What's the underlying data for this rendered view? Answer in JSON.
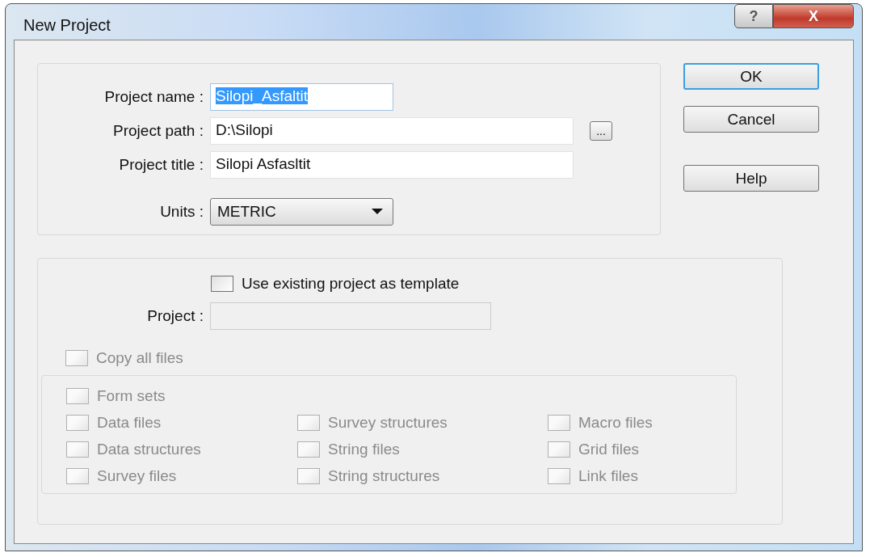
{
  "window": {
    "title": "New Project",
    "help_button": "?",
    "close_button": "X"
  },
  "fields": [
    {
      "label": "Project name :",
      "value": "Silopi_Asfaltit",
      "text_highlighted": true,
      "kind": "text"
    },
    {
      "label": "Project path :",
      "value": "D:\\Silopi",
      "kind": "browse",
      "browse_button": "..."
    },
    {
      "label": "Project title :",
      "value": "Silopi Asfasltit",
      "kind": "text"
    },
    {
      "label": "Units :",
      "value": "METRIC",
      "kind": "dropdown"
    }
  ],
  "buttons": [
    {
      "label": "OK",
      "default": true
    },
    {
      "label": "Cancel",
      "default": false
    },
    {
      "label": "Help",
      "default": false
    }
  ],
  "template": {
    "checkbox": {
      "label": "Use existing project as template",
      "checked": false,
      "disabled": false
    },
    "project_label": "Project :",
    "project_field_disabled": true,
    "copy_all": {
      "label": "Copy all files",
      "checked": false,
      "disabled": true
    },
    "file_option_rows": [
      [
        {
          "label": "Form sets",
          "checked": false,
          "disabled": true
        }
      ],
      [
        {
          "label": "Data files",
          "checked": false,
          "disabled": true
        },
        {
          "label": "Survey structures",
          "checked": false,
          "disabled": true
        },
        {
          "label": "Macro files",
          "checked": false,
          "disabled": true
        }
      ],
      [
        {
          "label": "Data structures",
          "checked": false,
          "disabled": true
        },
        {
          "label": "String files",
          "checked": false,
          "disabled": true
        },
        {
          "label": "Grid files",
          "checked": false,
          "disabled": true
        }
      ],
      [
        {
          "label": "Survey files",
          "checked": false,
          "disabled": true
        },
        {
          "label": "String structures",
          "checked": false,
          "disabled": true
        },
        {
          "label": "Link files",
          "checked": false,
          "disabled": true
        }
      ]
    ]
  }
}
